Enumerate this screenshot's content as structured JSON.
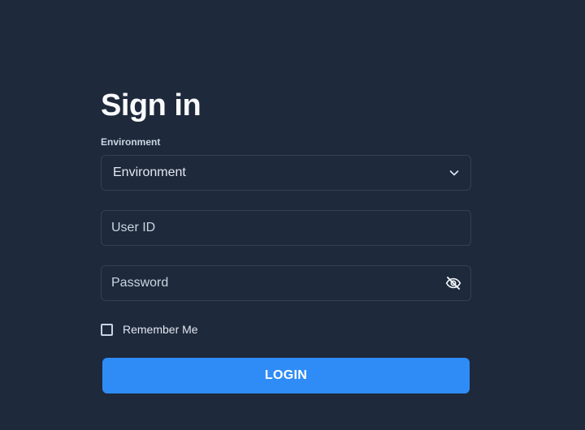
{
  "heading": "Sign in",
  "environment": {
    "label": "Environment",
    "selected": "Environment"
  },
  "user_id": {
    "placeholder": "User ID",
    "value": ""
  },
  "password": {
    "placeholder": "Password",
    "value": "",
    "toggle_icon": "eye-off-icon"
  },
  "remember": {
    "label": "Remember Me",
    "checked": false
  },
  "login_button": {
    "label": "LOGIN"
  },
  "colors": {
    "background": "#1e293b",
    "accent": "#2f8cf7",
    "border": "#334155"
  }
}
